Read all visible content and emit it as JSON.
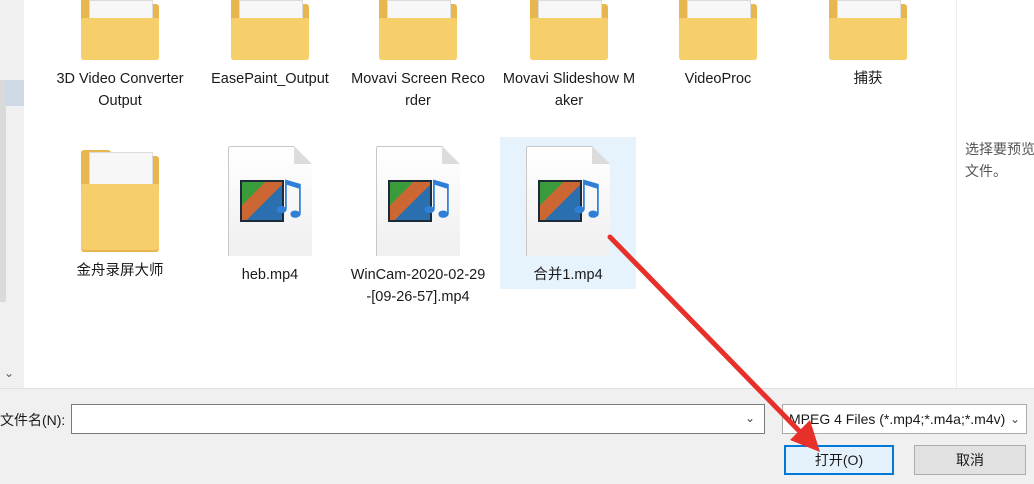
{
  "files": [
    {
      "type": "folder",
      "label": "3D Video Converter Output"
    },
    {
      "type": "folder",
      "label": "EasePaint_Output"
    },
    {
      "type": "folder",
      "label": "Movavi Screen Recorder"
    },
    {
      "type": "folder",
      "label": "Movavi Slideshow Maker"
    },
    {
      "type": "folder",
      "label": "VideoProc"
    },
    {
      "type": "folder",
      "label": "捕获"
    },
    {
      "type": "folder",
      "label": "金舟录屏大师"
    },
    {
      "type": "mp4",
      "label": "heb.mp4"
    },
    {
      "type": "mp4",
      "label": "WinCam-2020-02-29-[09-26-57].mp4"
    },
    {
      "type": "mp4",
      "label": "合并1.mp4"
    }
  ],
  "preview": {
    "message": "选择要预览的文件。"
  },
  "filename": {
    "label": "文件名(N):",
    "value": ""
  },
  "filter": {
    "value": "MPEG 4 Files (*.mp4;*.m4a;*.m4v)"
  },
  "buttons": {
    "open": "打开(O)",
    "cancel": "取消"
  },
  "annotation": {
    "color": "#e8302a"
  }
}
